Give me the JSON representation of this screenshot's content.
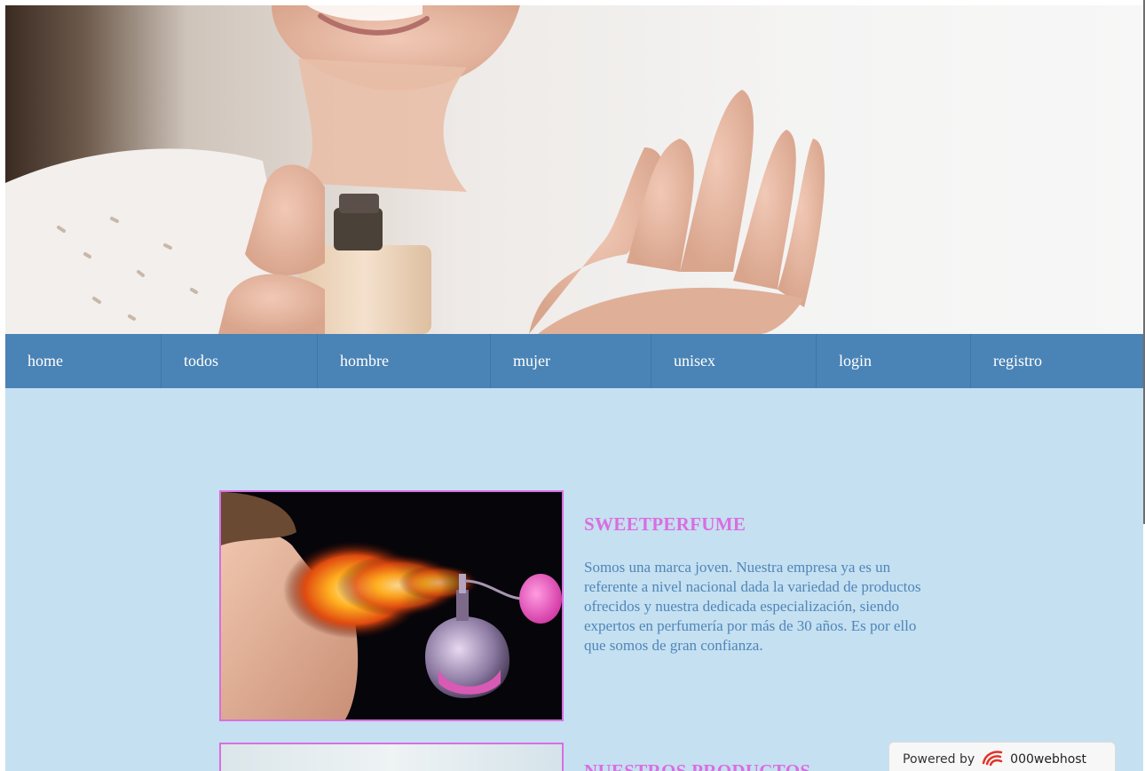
{
  "nav": {
    "items": [
      {
        "label": "home"
      },
      {
        "label": "todos"
      },
      {
        "label": "hombre"
      },
      {
        "label": "mujer"
      },
      {
        "label": "unisex"
      },
      {
        "label": "login"
      },
      {
        "label": "registro"
      }
    ]
  },
  "about": {
    "title": "SWEETPERFUME",
    "text": "Somos una marca joven. Nuestra empresa ya es un referente a nivel nacional dada la variedad de productos ofrecidos y nuestra dedicada especialización, siendo expertos en perfumería por más de 30 años. Es por ello que somos de gran confianza."
  },
  "section2": {
    "title": "NUESTROS PRODUCTOS"
  },
  "badge": {
    "prefix": "Powered by",
    "host": "000webhost",
    "logo_icon": "000webhost-logo-icon"
  },
  "colors": {
    "nav_bg": "#4a83b5",
    "content_bg": "#c5e0f1",
    "accent_pink": "#d96ee0",
    "text_blue": "#4f86b8"
  }
}
